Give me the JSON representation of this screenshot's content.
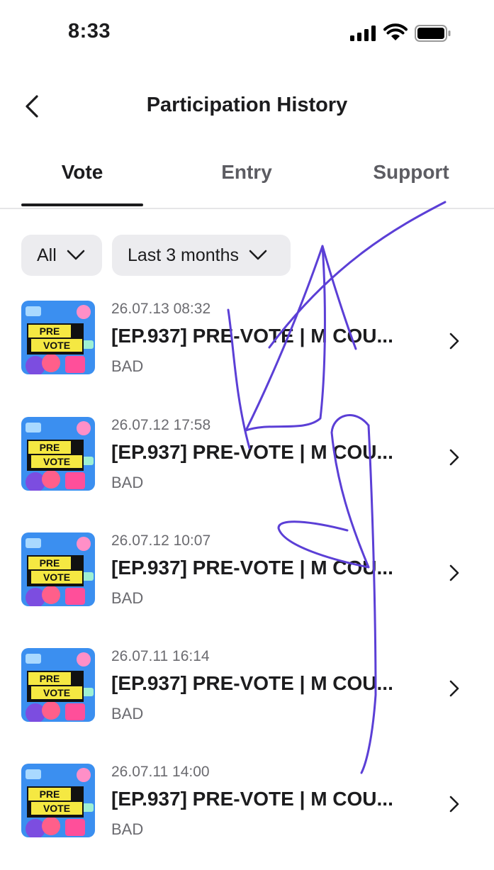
{
  "status_bar": {
    "time": "8:33"
  },
  "header": {
    "title": "Participation History",
    "back_icon": "chevron-left-icon"
  },
  "tabs": [
    {
      "label": "Vote",
      "active": true
    },
    {
      "label": "Entry",
      "active": false
    },
    {
      "label": "Support",
      "active": false
    }
  ],
  "filters": {
    "type": {
      "label": "All"
    },
    "period": {
      "label": "Last 3 months"
    }
  },
  "items": [
    {
      "date": "26.07.13 08:32",
      "title": "[EP.937] PRE-VOTE | M COU...",
      "artist": "BAD",
      "thumb_top": "PRE",
      "thumb_bottom": "VOTE"
    },
    {
      "date": "26.07.12 17:58",
      "title": "[EP.937] PRE-VOTE | M COU...",
      "artist": "BAD",
      "thumb_top": "PRE",
      "thumb_bottom": "VOTE"
    },
    {
      "date": "26.07.12 10:07",
      "title": "[EP.937] PRE-VOTE | M COU...",
      "artist": "BAD",
      "thumb_top": "PRE",
      "thumb_bottom": "VOTE"
    },
    {
      "date": "26.07.11 16:14",
      "title": "[EP.937] PRE-VOTE | M COU...",
      "artist": "BAD",
      "thumb_top": "PRE",
      "thumb_bottom": "VOTE"
    },
    {
      "date": "26.07.11 14:00",
      "title": "[EP.937] PRE-VOTE | M COU...",
      "artist": "BAD",
      "thumb_top": "PRE",
      "thumb_bottom": "VOTE"
    }
  ],
  "colors": {
    "scribble": "#5b3fd6",
    "chip_bg": "#ececef",
    "thumb_bg": "#3b8ff0",
    "thumb_label": "#f5e842"
  }
}
